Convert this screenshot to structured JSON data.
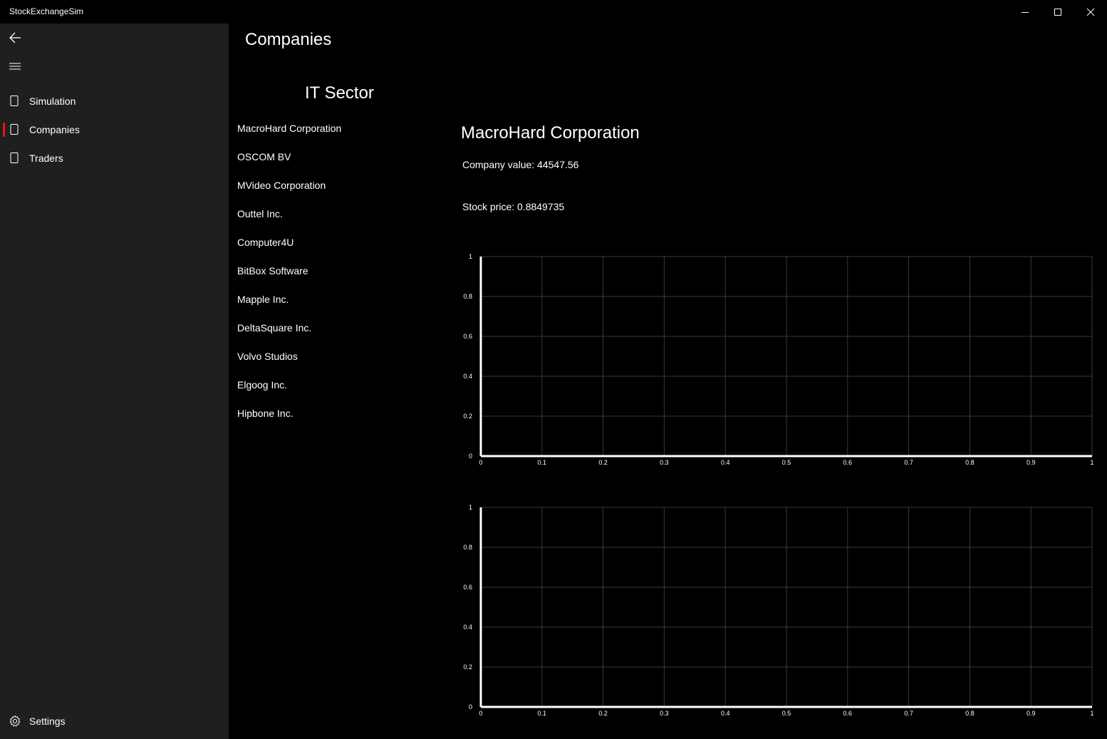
{
  "window": {
    "title": "StockExchangeSim"
  },
  "nav": {
    "items": [
      {
        "label": "Simulation",
        "selected": false
      },
      {
        "label": "Companies",
        "selected": true
      },
      {
        "label": "Traders",
        "selected": false
      }
    ],
    "settings_label": "Settings",
    "accent_color": "#e81123"
  },
  "page": {
    "title": "Companies"
  },
  "sector": {
    "title": "IT Sector",
    "companies": [
      "MacroHard Corporation",
      "OSCOM BV",
      "MVideo Corporation",
      "Outtel Inc.",
      "Computer4U",
      "BitBox Software",
      "Mapple Inc.",
      "DeltaSquare Inc.",
      "Volvo Studios",
      "Elgoog Inc.",
      "Hipbone Inc."
    ]
  },
  "detail": {
    "company_name": "MacroHard Corporation",
    "company_value_text": "Company value: 44547.56",
    "stock_price_text": "Stock price: 0.8849735"
  },
  "chart_data": [
    {
      "type": "line",
      "series": [],
      "xlim": [
        0,
        1
      ],
      "ylim": [
        0,
        1
      ],
      "x_ticks": [
        "0",
        "0.1",
        "0.2",
        "0.3",
        "0.4",
        "0.5",
        "0.6",
        "0.7",
        "0.8",
        "0.9",
        "1"
      ],
      "y_ticks": [
        "0",
        "0.2",
        "0.4",
        "0.6",
        "0.8",
        "1"
      ],
      "grid": true
    },
    {
      "type": "line",
      "series": [],
      "xlim": [
        0,
        1
      ],
      "ylim": [
        0,
        1
      ],
      "x_ticks": [
        "0",
        "0.1",
        "0.2",
        "0.3",
        "0.4",
        "0.5",
        "0.6",
        "0.7",
        "0.8",
        "0.9",
        "1"
      ],
      "y_ticks": [
        "0",
        "0.2",
        "0.4",
        "0.6",
        "0.8",
        "1"
      ],
      "grid": true
    }
  ]
}
